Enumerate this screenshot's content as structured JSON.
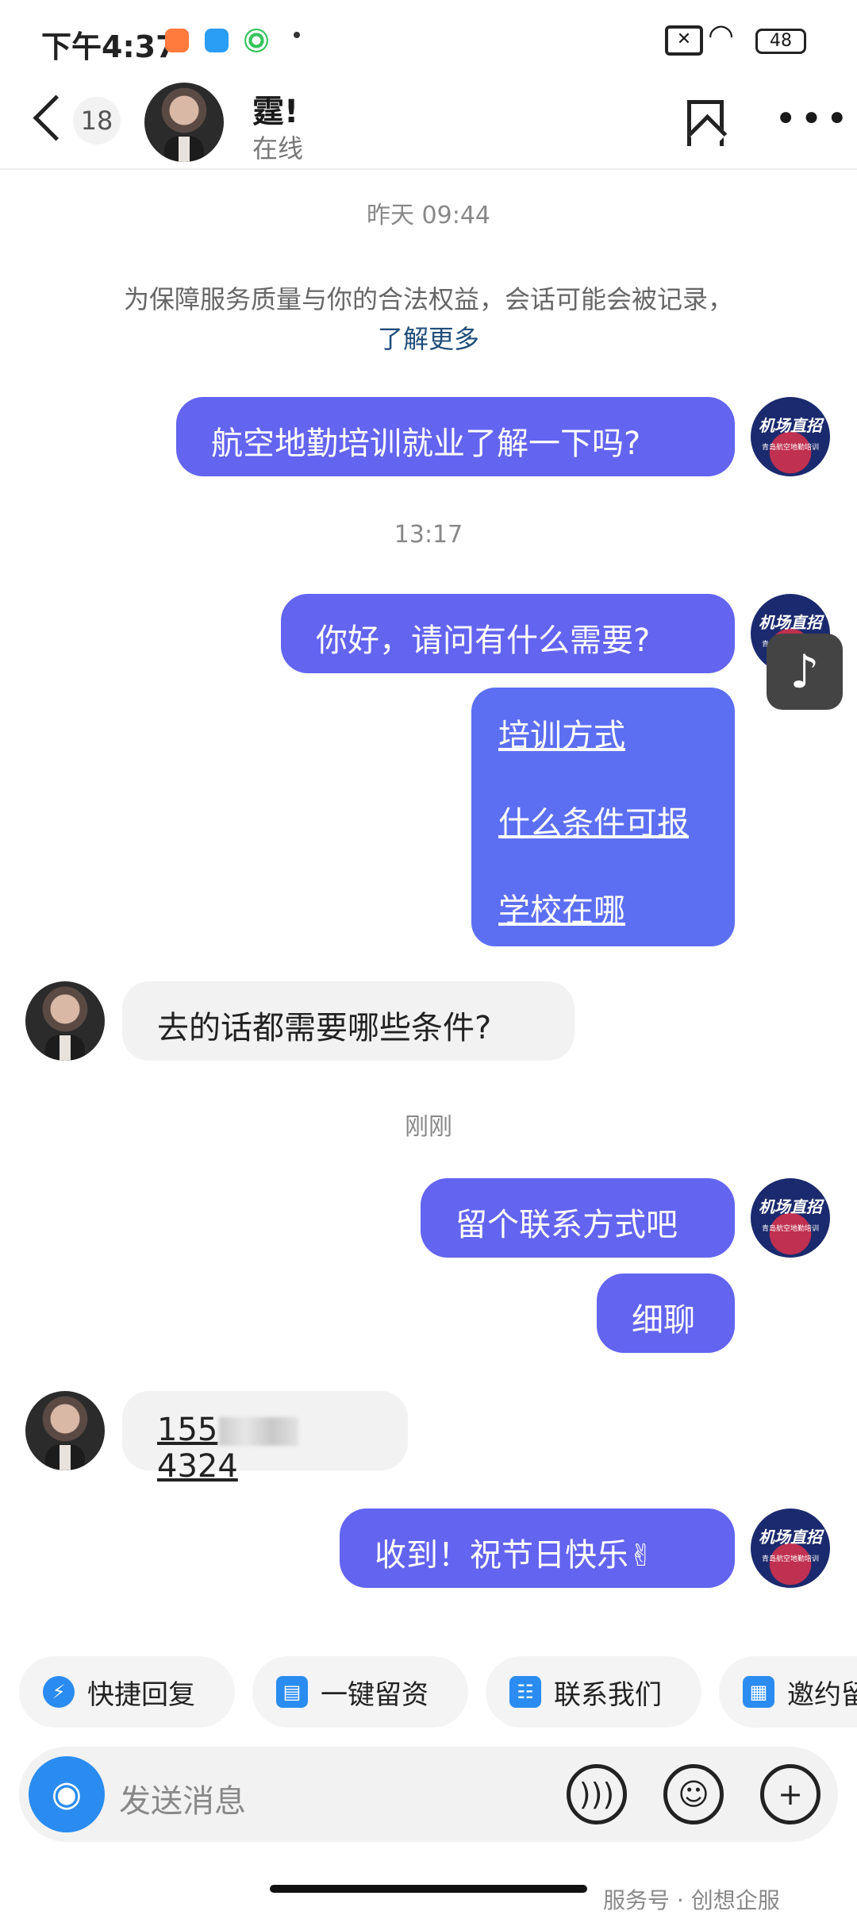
{
  "status_bar": {
    "time": "下午4:37",
    "battery": "48"
  },
  "header": {
    "unread_count": "18",
    "contact_name": "霆!",
    "contact_status": "在线"
  },
  "chat": {
    "timestamp_1": "昨天 09:44",
    "notice": "为保障服务质量与你的合法权益，会话可能会被记录，",
    "notice_link": "了解更多",
    "msg_1": "航空地勤培训就业了解一下吗?",
    "timestamp_2": "13:17",
    "msg_2": "你好，请问有什么需要?",
    "options": [
      "培训方式",
      "什么条件可报",
      "学校在哪"
    ],
    "msg_3": "去的话都需要哪些条件?",
    "timestamp_3": "刚刚",
    "msg_4": "留个联系方式吧",
    "msg_5": "细聊",
    "phone_prefix": "155",
    "phone_suffix": "4324",
    "msg_6": "收到！祝节日快乐",
    "brand_avatar_text": "机场直招",
    "brand_avatar_sub": "青岛航空地勤培训"
  },
  "quick_replies": [
    "快捷回复",
    "一键留资",
    "联系我们",
    "邀约留"
  ],
  "input": {
    "placeholder": "发送消息"
  },
  "watermark": "服务号 · 创想企服",
  "colors": {
    "bubble_out": "#6364ef",
    "bubble_in": "#f2f2f2",
    "accent_blue": "#2a8cf0"
  },
  "icons": [
    "back-arrow-icon",
    "bookmark-icon",
    "more-icon",
    "camera-icon",
    "voice-icon",
    "emoji-icon",
    "plus-icon",
    "tiktok-icon",
    "lightning-icon",
    "form-icon",
    "contacts-icon",
    "calendar-icon"
  ]
}
